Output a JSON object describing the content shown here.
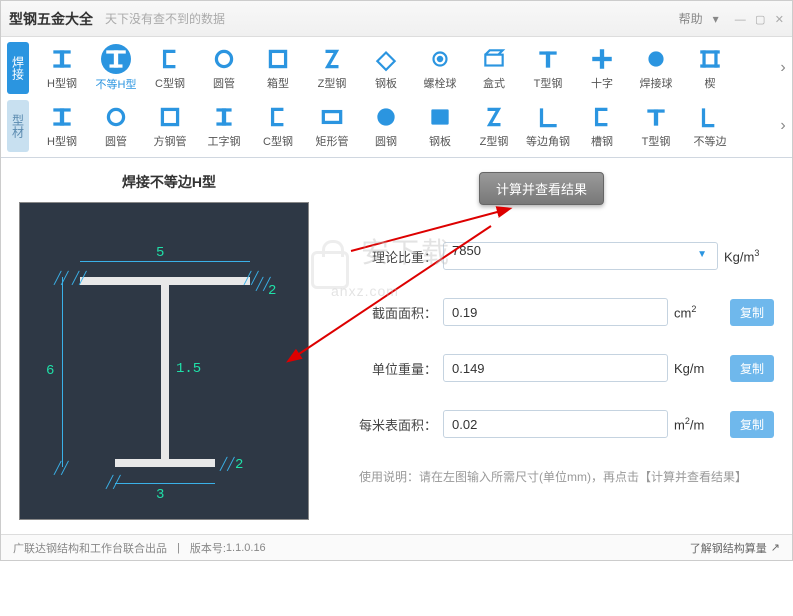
{
  "app": {
    "title": "型钢五金大全",
    "slogan": "天下没有查不到的数据",
    "help": "帮助"
  },
  "tabs": {
    "weld": "焊接",
    "profile": "型材"
  },
  "row1": [
    "H型钢",
    "不等H型",
    "C型钢",
    "圆管",
    "箱型",
    "Z型钢",
    "钢板",
    "螺栓球",
    "盒式",
    "T型钢",
    "十字",
    "焊接球",
    "楔"
  ],
  "row2": [
    "H型钢",
    "圆管",
    "方钢管",
    "工字钢",
    "C型钢",
    "矩形管",
    "圆钢",
    "钢板",
    "Z型钢",
    "等边角钢",
    "槽钢",
    "T型钢",
    "不等边"
  ],
  "diagram": {
    "title": "焊接不等边H型",
    "dims": {
      "top_width": "5",
      "top_thick": "2",
      "height": "6",
      "web_thick": "1.5",
      "bot_thick": "2",
      "bot_width": "3"
    }
  },
  "form": {
    "calc_btn": "计算并查看结果",
    "density_label": "理论比重：",
    "density_value": "7850",
    "density_unit": "Kg/m³",
    "area_label": "截面面积：",
    "area_value": "0.19",
    "area_unit": "cm²",
    "weight_label": "单位重量：",
    "weight_value": "0.149",
    "weight_unit": "Kg/m",
    "surface_label": "每米表面积：",
    "surface_value": "0.02",
    "surface_unit": "m²/m",
    "copy": "复制",
    "usage": "使用说明：请在左图输入所需尺寸(单位mm)，再点击【计算并查看结果】"
  },
  "status": {
    "credit": "广联达钢结构和工作台联合出品",
    "version_label": "版本号:",
    "version": "1.1.0.16",
    "link": "了解钢结构算量"
  }
}
